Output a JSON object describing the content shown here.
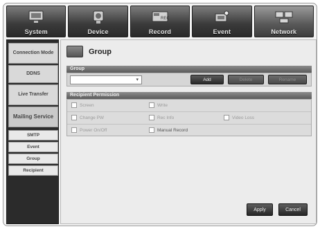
{
  "tabs": [
    {
      "label": "System",
      "icon": "monitor-icon"
    },
    {
      "label": "Device",
      "icon": "camera-icon"
    },
    {
      "label": "Record",
      "icon": "record-icon"
    },
    {
      "label": "Event",
      "icon": "event-icon"
    },
    {
      "label": "Network",
      "icon": "network-icon"
    }
  ],
  "sidebar": {
    "items": [
      {
        "label": "Connection Mode"
      },
      {
        "label": "DDNS"
      },
      {
        "label": "Live Transfer"
      },
      {
        "label": "Mailing Service"
      },
      {
        "label": "SMTP"
      },
      {
        "label": "Event"
      },
      {
        "label": "Group"
      },
      {
        "label": "Recipient"
      }
    ]
  },
  "page": {
    "title": "Group"
  },
  "group": {
    "section_label": "Group",
    "select_value": "",
    "add_label": "Add",
    "edit_label": "Delete",
    "delete_label": "Rename"
  },
  "permissions": {
    "section_label": "Recipient Permission",
    "items": [
      {
        "label": "Screen",
        "checked": false
      },
      {
        "label": "Write",
        "checked": false
      },
      {
        "label": "Change PW",
        "checked": false
      },
      {
        "label": "Rec Info",
        "checked": false
      },
      {
        "label": "Video Loss",
        "checked": false
      },
      {
        "label": "Power On/Off",
        "checked": false
      },
      {
        "label": "Manual Record",
        "checked": false
      }
    ]
  },
  "footer": {
    "apply_label": "Apply",
    "cancel_label": "Cancel"
  }
}
